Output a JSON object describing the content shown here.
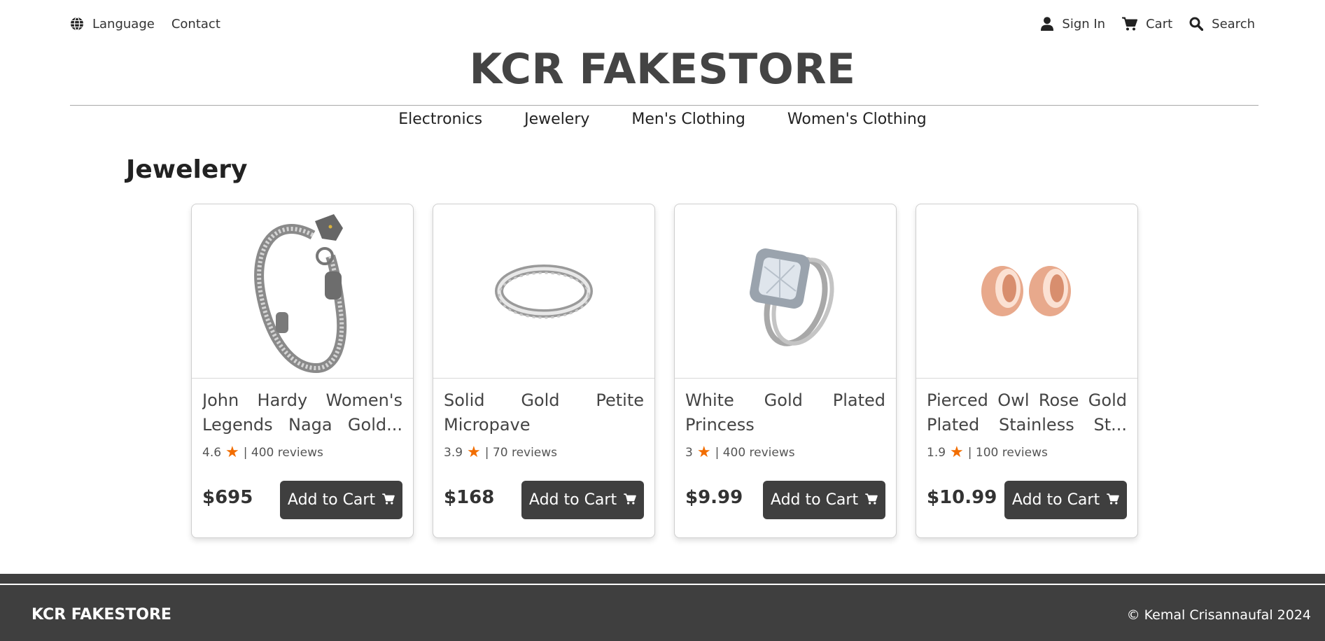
{
  "header": {
    "language_label": "Language",
    "contact_label": "Contact",
    "signin_label": "Sign In",
    "cart_label": "Cart",
    "search_label": "Search",
    "brand": "KCR FAKESTORE",
    "icons": {
      "language": "globe-icon",
      "signin": "user-icon",
      "cart": "cart-icon",
      "search": "search-icon"
    }
  },
  "nav": {
    "items": [
      {
        "label": "Electronics"
      },
      {
        "label": "Jewelery"
      },
      {
        "label": "Men's Clothing"
      },
      {
        "label": "Women's Clothing"
      }
    ]
  },
  "main": {
    "section_title": "Jewelery",
    "products": [
      {
        "name_line1": "John Hardy Women's",
        "name_line2": "Legends Naga Gold...",
        "rating": "4.6",
        "reviews": "| 400 reviews",
        "price": "$695",
        "button_label": "Add to Cart",
        "image": "silver-dragon-bracelet"
      },
      {
        "name_line1": "Solid Gold Petite",
        "name_line2": "Micropave",
        "rating": "3.9",
        "reviews": "| 70 reviews",
        "price": "$168",
        "button_label": "Add to Cart",
        "image": "silver-band-ring"
      },
      {
        "name_line1": "White Gold Plated",
        "name_line2": "Princess",
        "rating": "3",
        "reviews": "| 400 reviews",
        "price": "$9.99",
        "button_label": "Add to Cart",
        "image": "diamond-engagement-ring"
      },
      {
        "name_line1": "Pierced Owl Rose Gold",
        "name_line2": "Plated Stainless St...",
        "rating": "1.9",
        "reviews": "| 100 reviews",
        "price": "$10.99",
        "button_label": "Add to Cart",
        "image": "rose-gold-plugs"
      }
    ]
  },
  "footer": {
    "brand": "KCR FAKESTORE",
    "copyright": "© Kemal Crisannaufal 2024"
  },
  "colors": {
    "dark": "#3f3f3f",
    "star": "#f26d00",
    "text": "#444444"
  }
}
